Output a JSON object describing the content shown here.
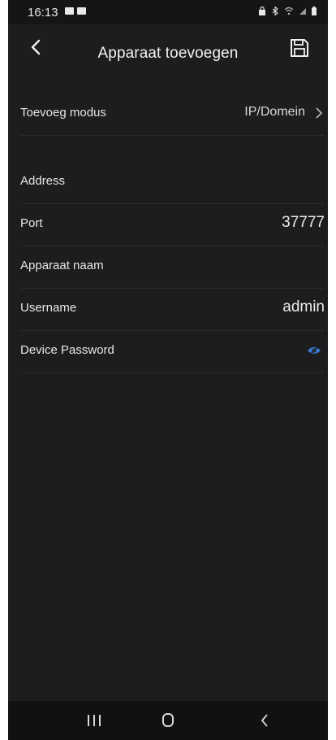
{
  "status_bar": {
    "time": "16:13",
    "left_icons": [
      "mail-icon",
      "image-icon"
    ],
    "right_icons": [
      "lock-icon",
      "bluetooth-icon",
      "wifi-icon",
      "signal-icon",
      "battery-icon"
    ]
  },
  "header": {
    "title": "Apparaat toevoegen",
    "back_icon": "back-arrow-icon",
    "save_icon": "save-icon"
  },
  "form": {
    "mode": {
      "label": "Toevoeg modus",
      "value": "IP/Domein"
    },
    "address": {
      "label": "Address",
      "value": ""
    },
    "port": {
      "label": "Port",
      "value": "37777"
    },
    "device_name": {
      "label": "Apparaat naam",
      "value": ""
    },
    "username": {
      "label": "Username",
      "value": "admin"
    },
    "password": {
      "label": "Device Password",
      "value": ""
    }
  },
  "colors": {
    "background": "#1d1d1f",
    "accent": "#3a7bd5",
    "divider": "#2b2b2e"
  },
  "nav_bar": {
    "icons": [
      "recents-icon",
      "home-icon",
      "back-icon"
    ]
  }
}
